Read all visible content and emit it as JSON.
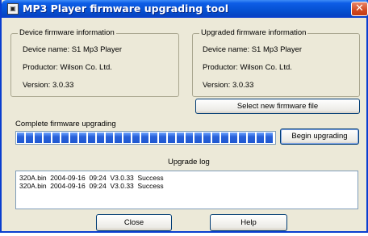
{
  "window": {
    "title": "MP3 Player firmware upgrading tool",
    "close_symbol": "✕",
    "icon": "app-icon",
    "accent": "#0a3ecf"
  },
  "device_info": {
    "group_title": "Device firmware information",
    "device_name": "Device name: S1 Mp3 Player",
    "productor": "Productor: Wilson Co. Ltd.",
    "version": "Version: 3.0.33"
  },
  "upgraded_info": {
    "group_title": "Upgraded firmware information",
    "device_name": "Device name: S1 Mp3 Player",
    "productor": "Productor: Wilson Co. Ltd.",
    "version": "Version: 3.0.33"
  },
  "select_firmware_button": "Select new firmware file",
  "progress": {
    "label": "Complete firmware upgrading",
    "fraction": 1.0,
    "color": "#2a62d9"
  },
  "begin_button": "Begin upgrading",
  "log": {
    "title": "Upgrade log",
    "lines": [
      "320A.bin  2004-09-16  09:24  V3.0.33  Success",
      "320A.bin  2004-09-16  09:24  V3.0.33  Success"
    ]
  },
  "close_button": "Close",
  "help_button": "Help"
}
